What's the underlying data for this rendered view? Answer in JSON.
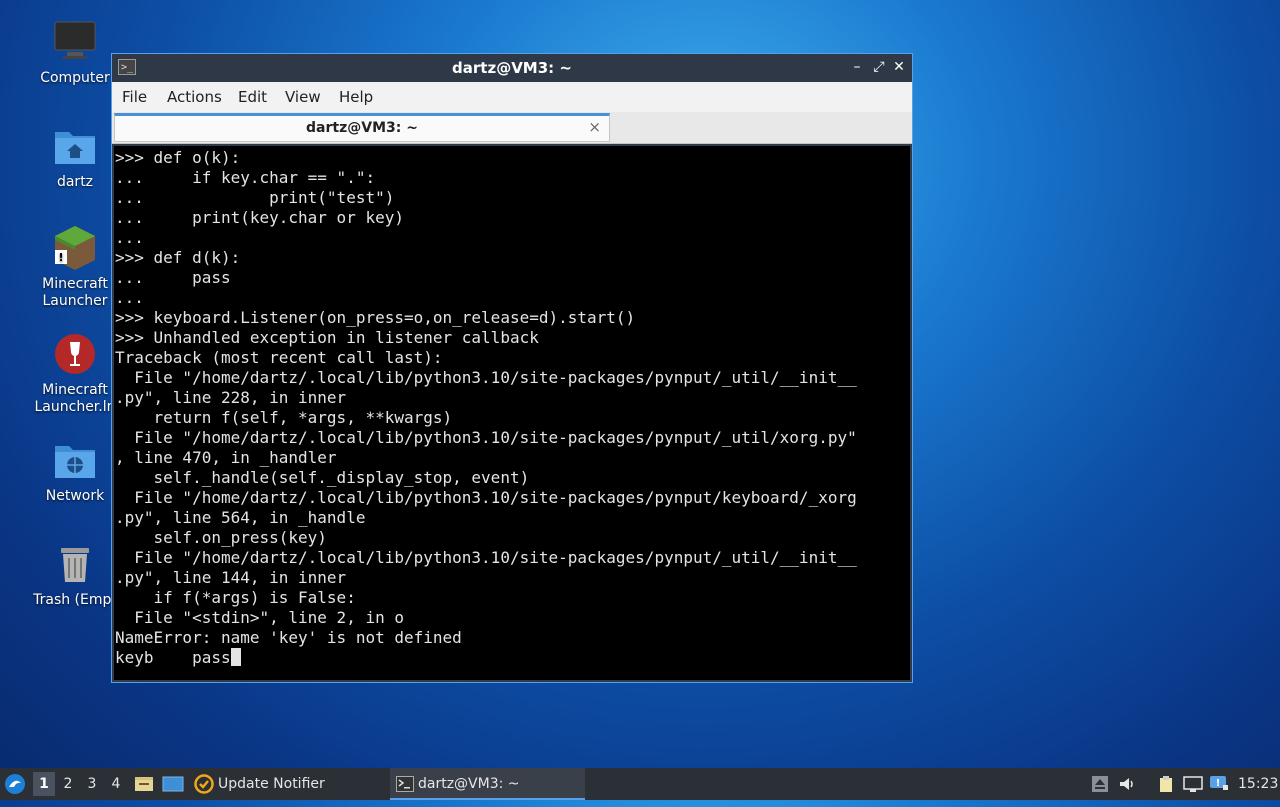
{
  "desktop": {
    "icons": [
      {
        "label": "Computer",
        "icon": "monitor-icon"
      },
      {
        "label": "dartz",
        "icon": "home-folder-icon"
      },
      {
        "label": "Minecraft Launcher",
        "icon": "minecraft-icon"
      },
      {
        "label": "Minecraft Launcher.ln",
        "icon": "wine-icon"
      },
      {
        "label": "Network",
        "icon": "network-folder-icon"
      },
      {
        "label": "Trash (Empt",
        "icon": "trash-icon"
      }
    ]
  },
  "window": {
    "title": "dartz@VM3: ~",
    "menu": [
      "File",
      "Actions",
      "Edit",
      "View",
      "Help"
    ],
    "tab": {
      "title": "dartz@VM3: ~",
      "close": "×"
    },
    "controls": {
      "minimize": "–",
      "maximize": "⤢",
      "close": "✕"
    },
    "terminal_lines": [
      ">>> def o(k):",
      "...     if key.char == \".\":",
      "...             print(\"test\")",
      "...     print(key.char or key)",
      "...",
      ">>> def d(k):",
      "...     pass",
      "...",
      ">>> keyboard.Listener(on_press=o,on_release=d).start()",
      ">>> Unhandled exception in listener callback",
      "Traceback (most recent call last):",
      "  File \"/home/dartz/.local/lib/python3.10/site-packages/pynput/_util/__init__",
      ".py\", line 228, in inner",
      "    return f(self, *args, **kwargs)",
      "  File \"/home/dartz/.local/lib/python3.10/site-packages/pynput/_util/xorg.py\"",
      ", line 470, in _handler",
      "    self._handle(self._display_stop, event)",
      "  File \"/home/dartz/.local/lib/python3.10/site-packages/pynput/keyboard/_xorg",
      ".py\", line 564, in _handle",
      "    self.on_press(key)",
      "  File \"/home/dartz/.local/lib/python3.10/site-packages/pynput/_util/__init__",
      ".py\", line 144, in inner",
      "    if f(*args) is False:",
      "  File \"<stdin>\", line 2, in o",
      "NameError: name 'key' is not defined"
    ],
    "prompt_line": "keyb    pass"
  },
  "taskbar": {
    "workspaces": [
      "1",
      "2",
      "3",
      "4"
    ],
    "active_workspace": "1",
    "tasks": [
      {
        "label": "Update Notifier",
        "icon": "update-notifier-icon"
      },
      {
        "label": "dartz@VM3: ~",
        "icon": "terminal-icon"
      }
    ],
    "clock": "15:23"
  },
  "colors": {
    "accent": "#5aa0e8",
    "titlebar": "#2e3846",
    "terminal_bg": "#000000",
    "terminal_fg": "#e4e4e4",
    "taskbar": "#2b2f36"
  }
}
